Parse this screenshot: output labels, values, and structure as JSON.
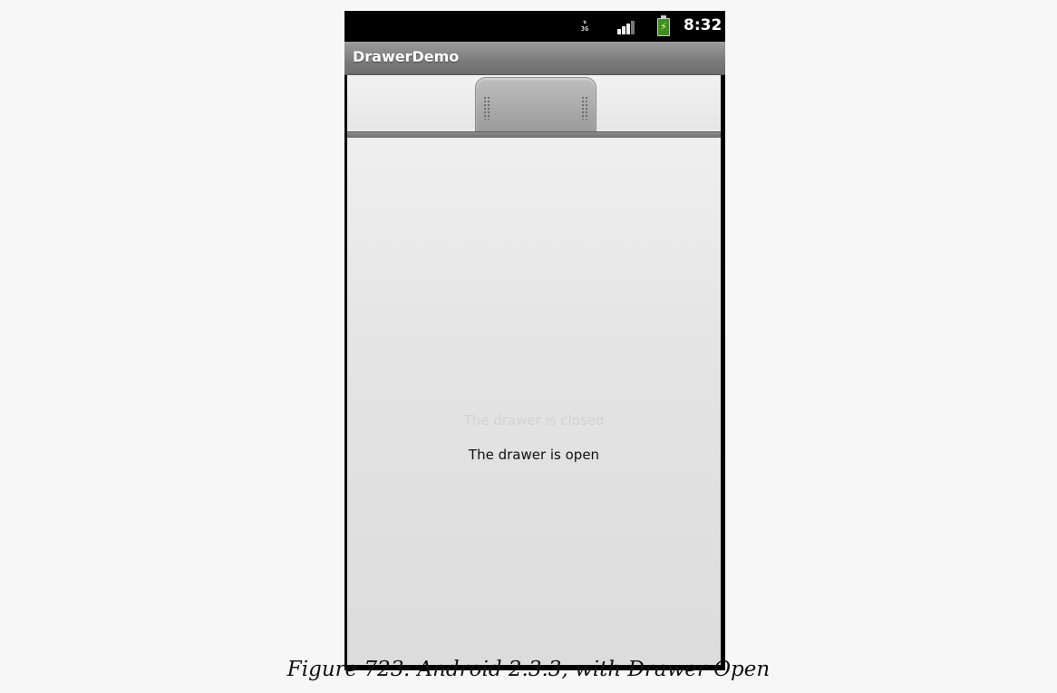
{
  "status_bar": {
    "network_label": "3G",
    "time": "8:32",
    "icons": [
      "network-3g-icon",
      "signal-strength-icon",
      "battery-charging-icon"
    ]
  },
  "app": {
    "title": "DrawerDemo"
  },
  "drawer": {
    "handle_icon": "drawer-handle-icon",
    "closed_text": "The drawer is closed",
    "open_text": "The drawer is open"
  },
  "caption": "Figure 723: Android 2.3.3, with Drawer Open"
}
